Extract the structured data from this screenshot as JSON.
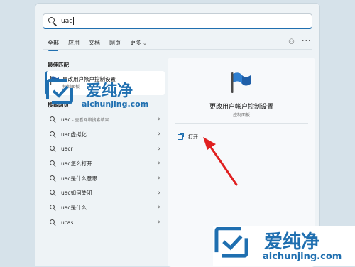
{
  "search": {
    "value": "uac"
  },
  "tabs": [
    {
      "label": "全部",
      "active": true
    },
    {
      "label": "应用"
    },
    {
      "label": "文档"
    },
    {
      "label": "网页"
    },
    {
      "label": "更多"
    }
  ],
  "best_match": {
    "section_label": "最佳匹配",
    "title": "更改用户帐户控制设置",
    "subtitle": "控制面板"
  },
  "web": {
    "section_label": "搜索网页",
    "items": [
      {
        "query": "uac",
        "suffix": "- 查看网络搜索结果"
      },
      {
        "query": "uac虚拟化",
        "suffix": ""
      },
      {
        "query": "uacr",
        "suffix": ""
      },
      {
        "query": "uac怎么打开",
        "suffix": ""
      },
      {
        "query": "uac是什么意思",
        "suffix": ""
      },
      {
        "query": "uac如何关闭",
        "suffix": ""
      },
      {
        "query": "uac是什么",
        "suffix": ""
      },
      {
        "query": "ucas",
        "suffix": ""
      }
    ]
  },
  "detail": {
    "title": "更改用户帐户控制设置",
    "subtitle": "控制面板",
    "open_label": "打开"
  },
  "watermark": {
    "brand": "爱纯净",
    "url": "aichunjing.com"
  },
  "colors": {
    "accent": "#1f6fb0",
    "arrow": "#e02020"
  }
}
